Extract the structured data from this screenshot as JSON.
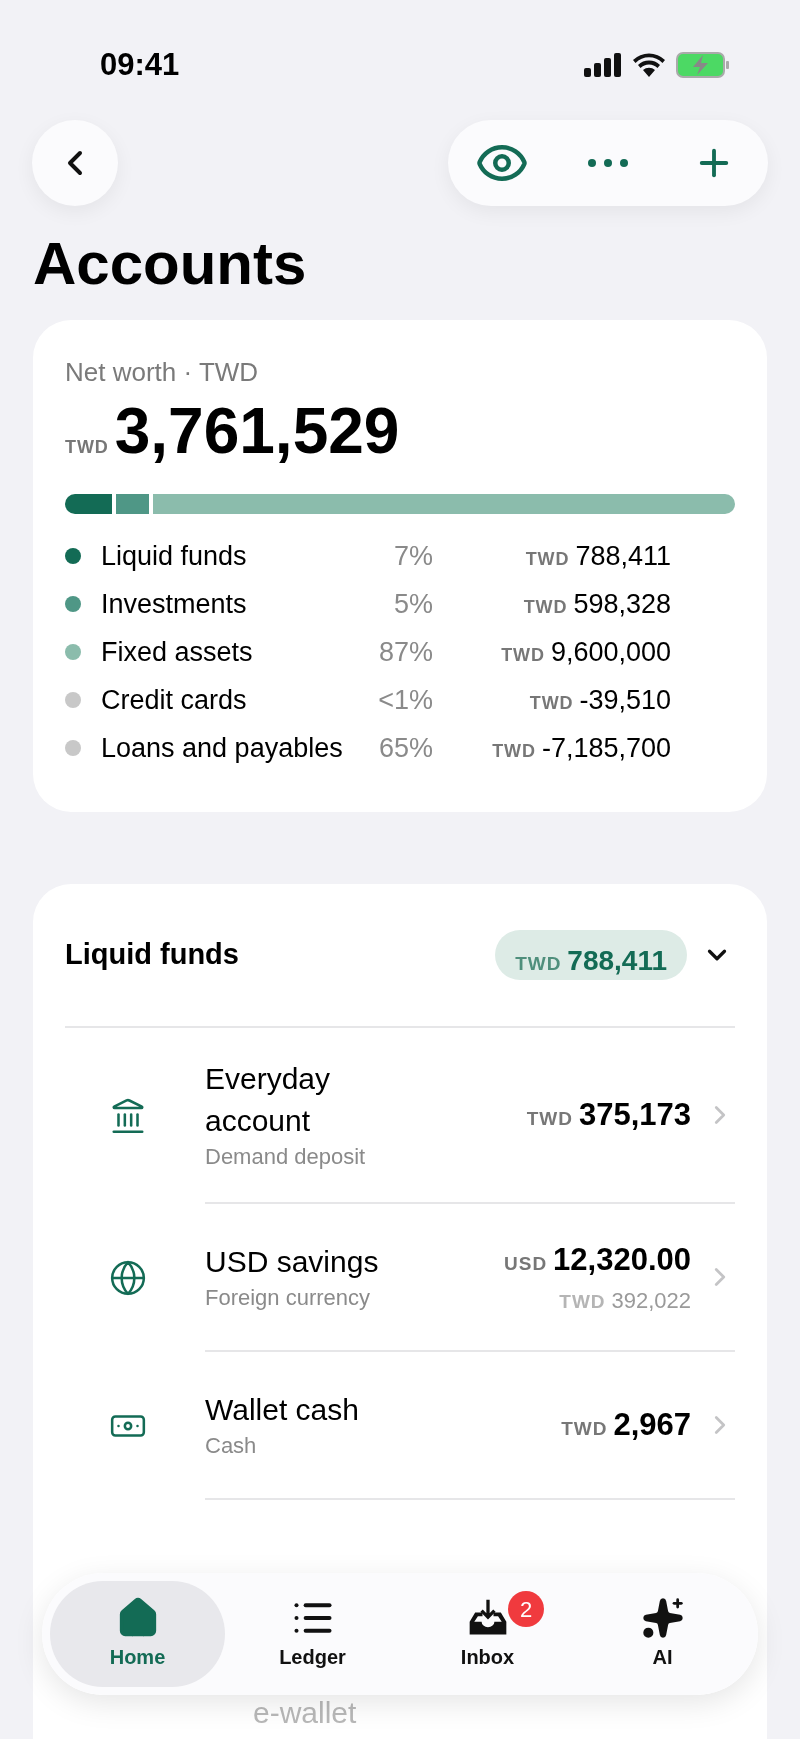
{
  "status_bar": {
    "time": "09:41"
  },
  "title": "Accounts",
  "net_worth": {
    "label": "Net worth · TWD",
    "currency": "TWD",
    "amount": "3,761,529",
    "categories": [
      {
        "kind": "asset",
        "name": "Liquid funds",
        "percent": "7%",
        "currency": "TWD",
        "amount": "788,411",
        "color": "#136b55"
      },
      {
        "kind": "asset",
        "name": "Investments",
        "percent": "5%",
        "currency": "TWD",
        "amount": "598,328",
        "color": "#4f9786"
      },
      {
        "kind": "asset",
        "name": "Fixed assets",
        "percent": "87%",
        "currency": "TWD",
        "amount": "9,600,000",
        "color": "#8bbcac"
      },
      {
        "kind": "liability",
        "name": "Credit cards",
        "percent": "<1%",
        "currency": "TWD",
        "amount": "-39,510",
        "color": "#c8c8c8"
      },
      {
        "kind": "liability",
        "name": "Loans and payables",
        "percent": "65%",
        "currency": "TWD",
        "amount": "-7,185,700",
        "color": "#c8c8c8"
      }
    ]
  },
  "group": {
    "title": "Liquid funds",
    "currency": "TWD",
    "total": "788,411",
    "expanded": true,
    "accounts": [
      {
        "kind": "bank",
        "name": "Everyday account",
        "subtitle": "Demand deposit",
        "currency": "TWD",
        "amount": "375,173"
      },
      {
        "kind": "globe",
        "name": "USD savings",
        "subtitle": "Foreign currency",
        "currency": "USD",
        "amount": "12,320.00",
        "secondary_currency": "TWD",
        "secondary_amount": "392,022"
      },
      {
        "kind": "cash",
        "name": "Wallet cash",
        "subtitle": "Cash",
        "currency": "TWD",
        "amount": "2,967"
      }
    ],
    "partial_row": {
      "name": "e-wallet"
    }
  },
  "tab_bar": [
    {
      "kind": "home",
      "label": "Home",
      "selected": true
    },
    {
      "kind": "list",
      "label": "Ledger",
      "selected": false
    },
    {
      "kind": "inbox",
      "label": "Inbox",
      "selected": false,
      "badge": "2"
    },
    {
      "kind": "sparkles",
      "label": "AI",
      "selected": false
    }
  ]
}
